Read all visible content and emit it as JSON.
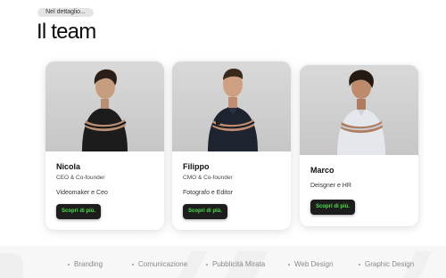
{
  "header": {
    "pill": "Nel dettaglio...",
    "title": "Il team"
  },
  "team": [
    {
      "name": "Nicola",
      "role": "CEO & Co-founder",
      "desc": "Videomaker e Ceo",
      "button": "Scopri di più."
    },
    {
      "name": "Filippo",
      "role": "CMO & Co-founder",
      "desc": "Fotografo e Editor",
      "button": "Scopri di più."
    },
    {
      "name": "Marco",
      "role": "",
      "desc": "Deisgner e HR",
      "button": "Scopri di più."
    }
  ],
  "services": [
    "Branding",
    "Comunicazione",
    "Pubblicità Mirata",
    "Web Design",
    "Graphic Design"
  ],
  "colors": {
    "button_bg": "#1d1d1d",
    "button_text": "#4be04b",
    "band": "#f7f7f7"
  }
}
